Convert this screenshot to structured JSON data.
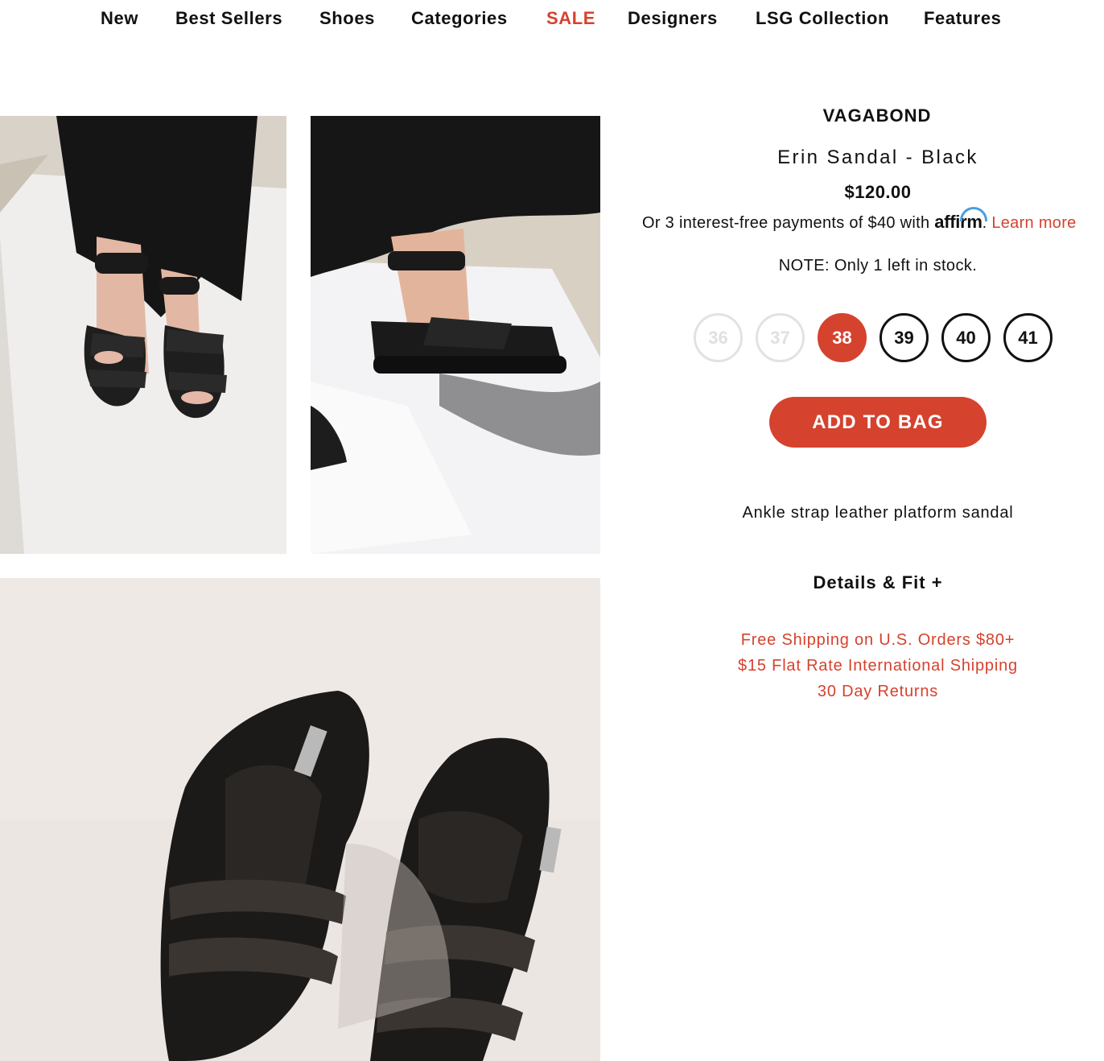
{
  "nav": {
    "items": [
      {
        "label": "New"
      },
      {
        "label": "Best Sellers"
      },
      {
        "label": "Shoes"
      },
      {
        "label": "Categories"
      },
      {
        "label": "SALE"
      },
      {
        "label": "Designers"
      },
      {
        "label": "LSG Collection"
      },
      {
        "label": "Features"
      }
    ]
  },
  "product": {
    "brand": "VAGABOND",
    "name": "Erin Sandal - Black",
    "price": "$120.00",
    "affirm": {
      "prefix": "Or 3 interest-free payments of $40 with",
      "logo_text": "affirm",
      "separator": ".",
      "link_label": "Learn more"
    },
    "stock_note": "NOTE: Only 1 left in stock.",
    "sizes": [
      {
        "label": "36",
        "state": "unavailable"
      },
      {
        "label": "37",
        "state": "unavailable"
      },
      {
        "label": "38",
        "state": "selected"
      },
      {
        "label": "39",
        "state": "available"
      },
      {
        "label": "40",
        "state": "available"
      },
      {
        "label": "41",
        "state": "available"
      }
    ],
    "add_to_bag_label": "ADD TO BAG",
    "description": "Ankle strap leather platform sandal",
    "details_label": "Details & Fit +",
    "shipping": [
      "Free Shipping on U.S. Orders $80+",
      "$15 Flat Rate International Shipping",
      "30 Day Returns"
    ]
  },
  "colors": {
    "accent": "#d5422e",
    "text": "#111111",
    "disabled": "#e2e2e2",
    "affirm_blue": "#4a9ee0"
  }
}
